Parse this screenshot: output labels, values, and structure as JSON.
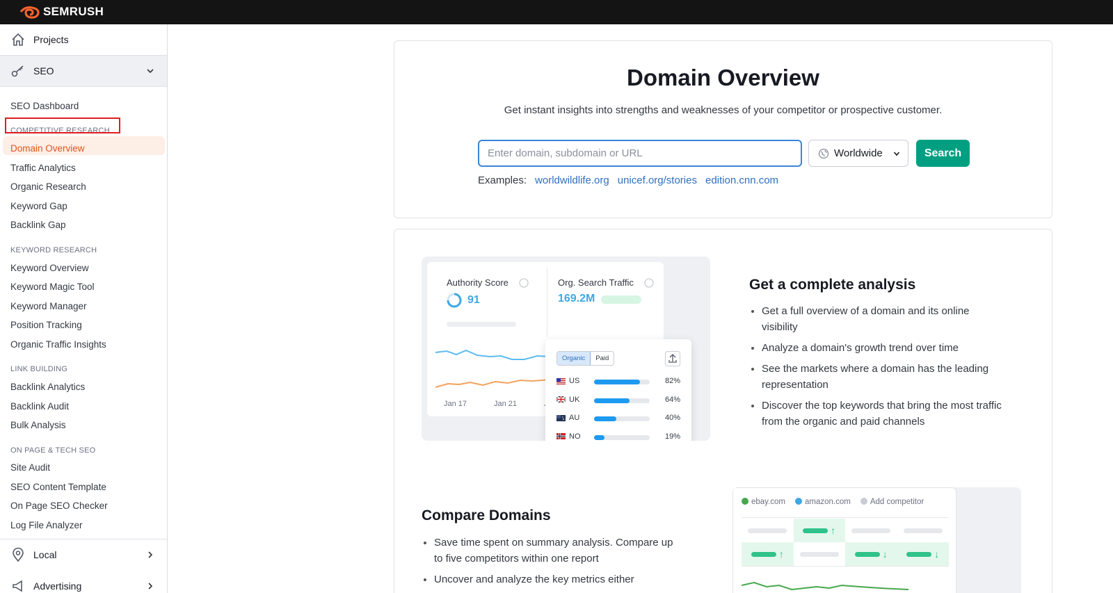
{
  "app": {
    "brand": "SEMRUSH",
    "brand_color": "#ff642d"
  },
  "sidebar": {
    "projects": "Projects",
    "seo": "SEO",
    "local": "Local",
    "advertising": "Advertising",
    "items": [
      {
        "label": "SEO Dashboard"
      },
      {
        "heading": "COMPETITIVE RESEARCH"
      },
      {
        "label": "Domain Overview",
        "active": true
      },
      {
        "label": "Traffic Analytics"
      },
      {
        "label": "Organic Research"
      },
      {
        "label": "Keyword Gap"
      },
      {
        "label": "Backlink Gap"
      },
      {
        "heading": "KEYWORD RESEARCH"
      },
      {
        "label": "Keyword Overview"
      },
      {
        "label": "Keyword Magic Tool"
      },
      {
        "label": "Keyword Manager"
      },
      {
        "label": "Position Tracking"
      },
      {
        "label": "Organic Traffic Insights"
      },
      {
        "heading": "LINK BUILDING"
      },
      {
        "label": "Backlink Analytics"
      },
      {
        "label": "Backlink Audit"
      },
      {
        "label": "Bulk Analysis"
      },
      {
        "heading": "ON PAGE & TECH SEO"
      },
      {
        "label": "Site Audit"
      },
      {
        "label": "SEO Content Template"
      },
      {
        "label": "On Page SEO Checker"
      },
      {
        "label": "Log File Analyzer"
      }
    ]
  },
  "search_card": {
    "title": "Domain Overview",
    "subtitle": "Get instant insights into strengths and weaknesses of your competitor or prospective customer.",
    "input_placeholder": "Enter domain, subdomain or URL",
    "region": "Worldwide",
    "search_button": "Search",
    "examples_label": "Examples:",
    "examples": [
      "worldwildlife.org",
      "unicef.org/stories",
      "edition.cnn.com"
    ]
  },
  "analysis": {
    "heading": "Get a complete analysis",
    "bullets": [
      "Get a full overview of a domain and its online visibility",
      "Analyze a domain's growth trend over time",
      "See the markets where a domain has the leading representation",
      "Discover the top keywords that bring the most traffic from the organic and paid channels"
    ],
    "illustration": {
      "authority_label": "Authority Score",
      "authority_value": "91",
      "traffic_label": "Org. Search Traffic",
      "traffic_value": "169.2M",
      "dates": [
        "Jan 17",
        "Jan 21",
        "J"
      ],
      "toggle": [
        "Organic",
        "Paid"
      ],
      "countries": [
        {
          "code": "US",
          "pct": "82%",
          "value": 0.82
        },
        {
          "code": "UK",
          "pct": "64%",
          "value": 0.64
        },
        {
          "code": "AU",
          "pct": "40%",
          "value": 0.4
        },
        {
          "code": "NO",
          "pct": "19%",
          "value": 0.19
        }
      ]
    }
  },
  "compare": {
    "heading": "Compare Domains",
    "bullets": [
      "Save time spent on summary analysis. Compare up to five competitors within one report",
      "Uncover and analyze the key metrics either"
    ],
    "illustration": {
      "legend": [
        {
          "label": "ebay.com",
          "color": "#45a84b"
        },
        {
          "label": "amazon.com",
          "color": "#3fa8e4"
        },
        {
          "label": "Add competitor",
          "color": "#c9ccd4"
        }
      ]
    }
  }
}
